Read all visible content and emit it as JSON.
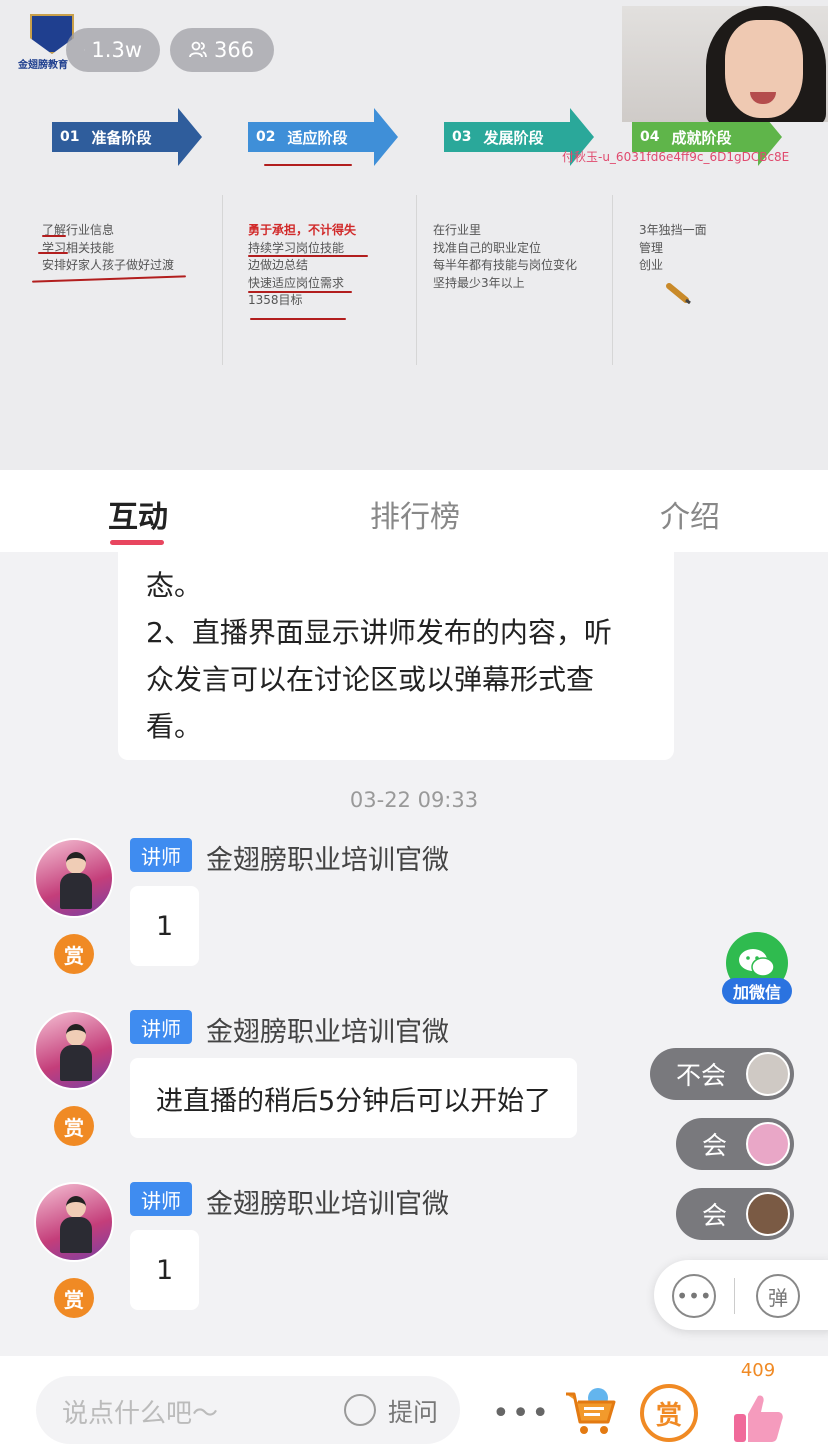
{
  "stream": {
    "logo_text": "金翅膀教育",
    "heat": "1.3w",
    "viewers": "366",
    "watermark": "付秋玉-u_6031fd6e4ff9c_6D1gDCBc8E"
  },
  "slide": {
    "stages": [
      {
        "num": "01",
        "label": "准备阶段",
        "color": "#2f5d9c"
      },
      {
        "num": "02",
        "label": "适应阶段",
        "color": "#3f8fd8"
      },
      {
        "num": "03",
        "label": "发展阶段",
        "color": "#2aa89a"
      },
      {
        "num": "04",
        "label": "成就阶段",
        "color": "#5fb54a"
      }
    ],
    "col1": [
      "了解行业信息",
      "学习相关技能",
      "安排好家人孩子做好过渡"
    ],
    "col2_title": "勇于承担，不计得失",
    "col2": [
      "持续学习岗位技能",
      "边做边总结",
      "快速适应岗位需求",
      "1358目标"
    ],
    "col3": [
      "在行业里",
      "找准自己的职业定位",
      "每半年都有技能与岗位变化",
      "坚持最少3年以上"
    ],
    "col4": [
      "3年独挡一面",
      "管理",
      "创业"
    ]
  },
  "tabs": {
    "interact": "互动",
    "ranking": "排行榜",
    "intro": "介绍"
  },
  "chat": {
    "system_lines": [
      "态。",
      "2、直播界面显示讲师发布的内容，听",
      "众发言可以在讨论区或以弹幕形式查",
      "看。"
    ],
    "timestamp": "03-22 09:33",
    "role_badge": "讲师",
    "reward_label": "赏",
    "messages": [
      {
        "sender": "金翅膀职业培训官微",
        "text": "1"
      },
      {
        "sender": "金翅膀职业培训官微",
        "text": "进直播的稍后5分钟后可以开始了"
      },
      {
        "sender": "金翅膀职业培训官微",
        "text": "1"
      }
    ]
  },
  "wechat_label": "加微信",
  "danmu": [
    {
      "text": "不会",
      "avatar_color": "#cfc9c4"
    },
    {
      "text": "会",
      "avatar_color": "#e9a7c7"
    },
    {
      "text": "会",
      "avatar_color": "#7a5a44"
    }
  ],
  "quick_danmu_label": "弹",
  "bottom": {
    "placeholder": "说点什么吧～",
    "ask_label": "提问",
    "more": "•••",
    "reward": "赏",
    "likes": "409"
  },
  "colors": {
    "accent": "#e8465f",
    "teacher_badge": "#3f8cf0",
    "reward": "#f08a24",
    "wechat": "#2fbb4f"
  }
}
